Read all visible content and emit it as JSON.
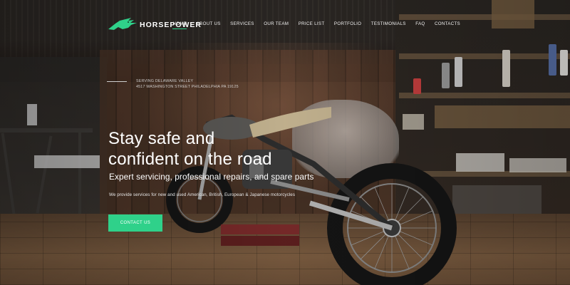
{
  "brand": {
    "name": "HORSEPOWER",
    "logo_icon": "horse-head-icon",
    "accent_color": "#2fd18a"
  },
  "nav": {
    "items": [
      {
        "label": "HOME",
        "active": true
      },
      {
        "label": "ABOUT US",
        "active": false
      },
      {
        "label": "SERVICES",
        "active": false
      },
      {
        "label": "OUR TEAM",
        "active": false
      },
      {
        "label": "PRICE LIST",
        "active": false
      },
      {
        "label": "PORTFOLIO",
        "active": false
      },
      {
        "label": "TESTIMONIALS",
        "active": false
      },
      {
        "label": "FAQ",
        "active": false
      },
      {
        "label": "CONTACTS",
        "active": false
      }
    ]
  },
  "address": {
    "line1": "SERVING DELAWARE VALLEY",
    "line2": "4517 WASHINGTON STREET PHILADELPHIA PA 19125"
  },
  "hero": {
    "headline_line1": "Stay safe and",
    "headline_line2": "confident on the road",
    "subheadline": "Expert servicing, professional repairs, and spare parts",
    "description": "We provide services for new and used American, British, European & Japanese motorcycles",
    "cta_label": "CONTACT US"
  }
}
